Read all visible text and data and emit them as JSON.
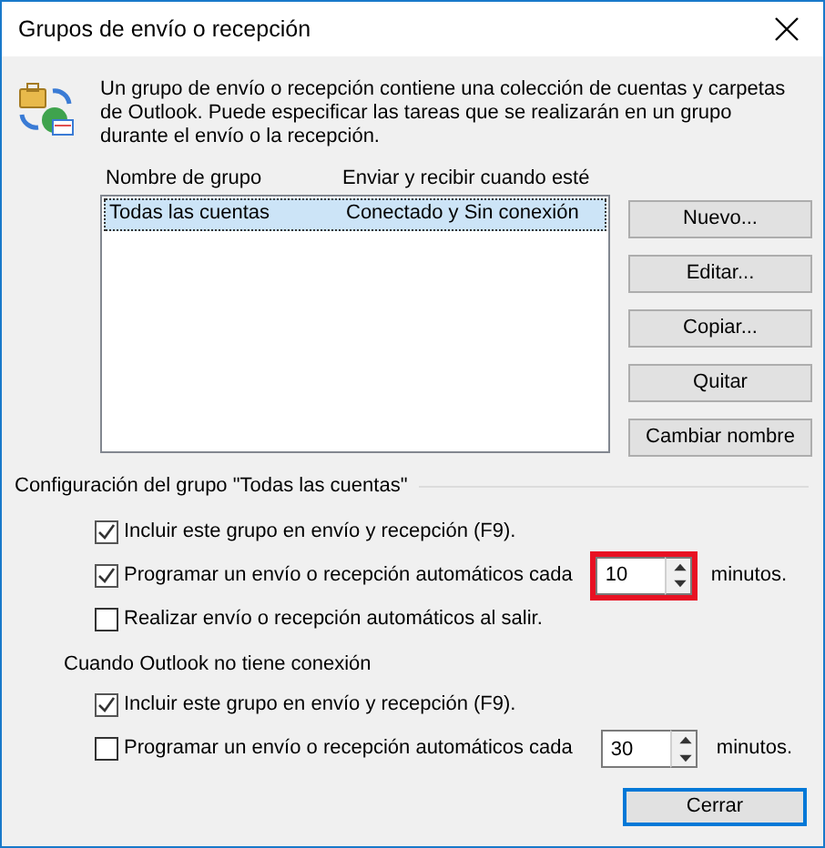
{
  "window": {
    "title": "Grupos de envío o recepción"
  },
  "description": "Un grupo de envío o recepción contiene una colección de cuentas y carpetas de Outlook. Puede especificar las tareas que se realizarán en un grupo durante el envío o la recepción.",
  "groups_list": {
    "columns": [
      "Nombre de grupo",
      "Enviar y recibir cuando esté"
    ],
    "rows": [
      {
        "cells": [
          "Todas las cuentas",
          "Conectado y Sin conexión"
        ],
        "selected": true
      }
    ]
  },
  "side_buttons": [
    "Nuevo...",
    "Editar...",
    "Copiar...",
    "Quitar",
    "Cambiar nombre"
  ],
  "sections": [
    {
      "kind": "groupbox",
      "title": "Configuración del grupo \"Todas las cuentas\"",
      "options": [
        {
          "label": "Incluir este grupo en envío y recepción (F9).",
          "checked": true
        },
        {
          "label": "Programar un envío o recepción automáticos cada",
          "checked": true,
          "spinner": {
            "value": "10",
            "highlighted": true
          },
          "unit": "minutos."
        },
        {
          "label": "Realizar envío o recepción automáticos al salir.",
          "checked": false
        }
      ]
    },
    {
      "kind": "caption",
      "title": "Cuando Outlook no tiene conexión",
      "options": [
        {
          "label": "Incluir este grupo en envío y recepción (F9).",
          "checked": true
        },
        {
          "label": "Programar un envío o recepción automáticos cada",
          "checked": false,
          "spinner": {
            "value": "30",
            "highlighted": false
          },
          "unit": "minutos."
        }
      ]
    }
  ],
  "close_button": "Cerrar"
}
